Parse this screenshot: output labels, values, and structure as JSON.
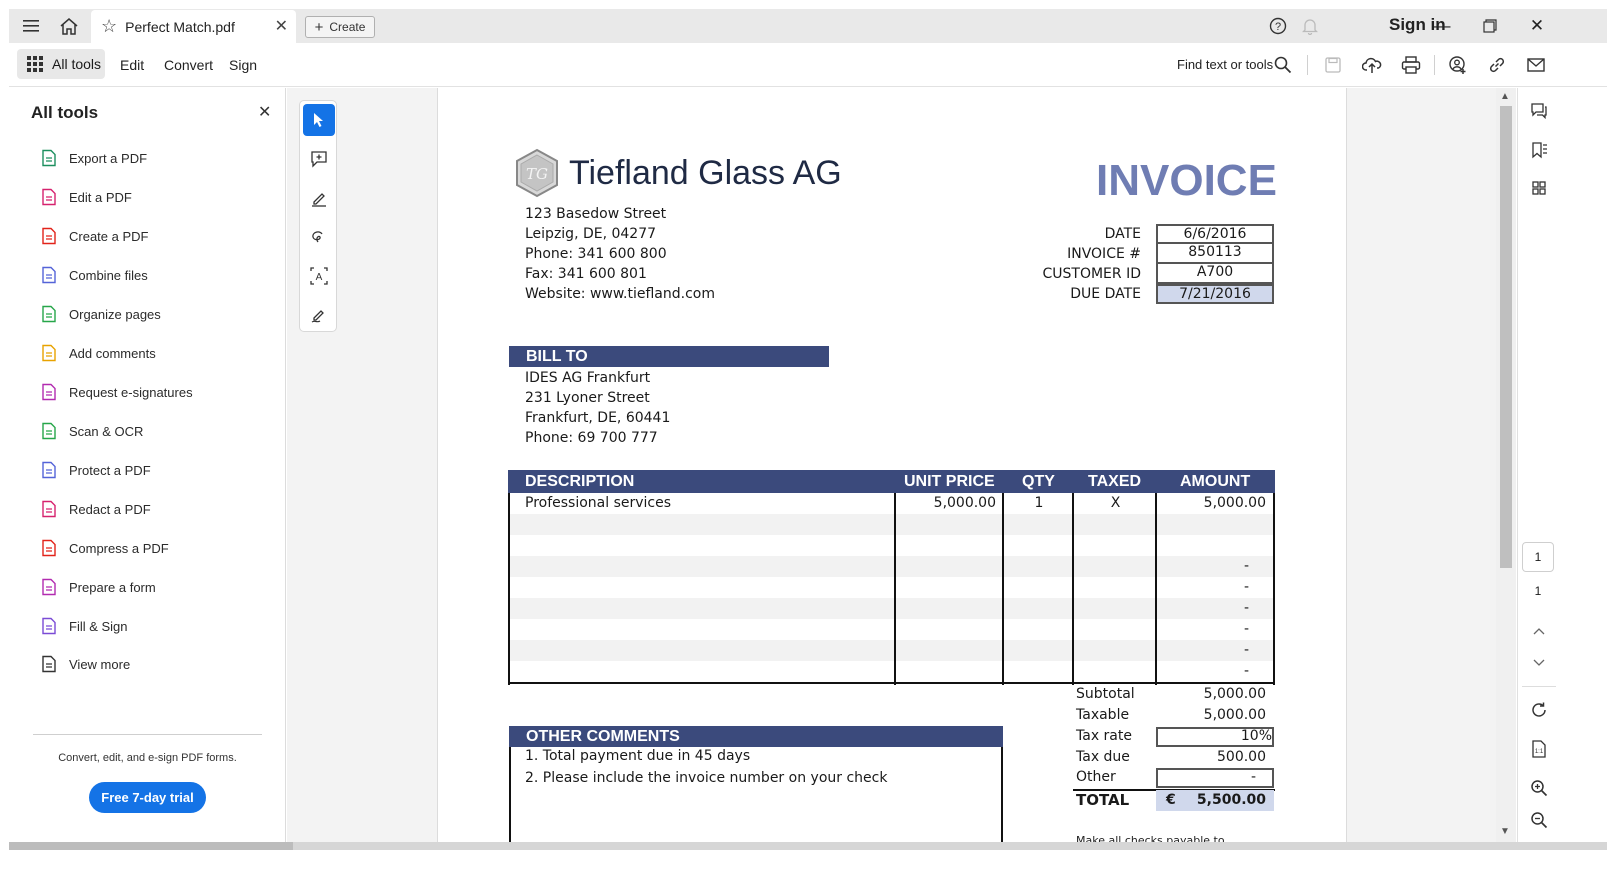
{
  "tabbar": {
    "tab_title": "Perfect Match.pdf",
    "create_label": "Create",
    "signin_label": "Sign in"
  },
  "toolbar": {
    "alltools_label": "All tools",
    "menu": [
      "Edit",
      "Convert",
      "Sign"
    ],
    "find_label": "Find text or tools"
  },
  "left_panel": {
    "title": "All tools",
    "items": [
      {
        "label": "Export a PDF",
        "icon": "export-pdf-icon",
        "color": "#1c8f5f"
      },
      {
        "label": "Edit a PDF",
        "icon": "edit-pdf-icon",
        "color": "#d6226e"
      },
      {
        "label": "Create a PDF",
        "icon": "create-pdf-icon",
        "color": "#e2231a"
      },
      {
        "label": "Combine files",
        "icon": "combine-files-icon",
        "color": "#5463d8"
      },
      {
        "label": "Organize pages",
        "icon": "organize-pages-icon",
        "color": "#26a649"
      },
      {
        "label": "Add comments",
        "icon": "add-comments-icon",
        "color": "#e8a200"
      },
      {
        "label": "Request e-signatures",
        "icon": "request-esign-icon",
        "color": "#b22bb0"
      },
      {
        "label": "Scan & OCR",
        "icon": "scan-ocr-icon",
        "color": "#26a649"
      },
      {
        "label": "Protect a PDF",
        "icon": "protect-pdf-icon",
        "color": "#5463d8"
      },
      {
        "label": "Redact a PDF",
        "icon": "redact-pdf-icon",
        "color": "#d6226e"
      },
      {
        "label": "Compress a PDF",
        "icon": "compress-pdf-icon",
        "color": "#e2231a"
      },
      {
        "label": "Prepare a form",
        "icon": "prepare-form-icon",
        "color": "#b22bb0"
      },
      {
        "label": "Fill & Sign",
        "icon": "fill-sign-icon",
        "color": "#7b4bd6"
      },
      {
        "label": "View more",
        "icon": "wrench-icon",
        "color": "#333333"
      }
    ],
    "promo_text": "Convert, edit, and e-sign PDF forms.",
    "trial_label": "Free 7-day trial"
  },
  "page_nav": {
    "current": "1",
    "total": "1"
  },
  "invoice": {
    "logo_text": "TG",
    "company": "Tiefland Glass AG",
    "title": "INVOICE",
    "address": [
      "123 Basedow Street",
      "Leipzig, DE, 04277",
      "Phone: 341 600 800",
      "Fax: 341 600 801",
      "Website: www.tiefland.com"
    ],
    "meta": [
      {
        "label": "DATE",
        "value": "6/6/2016"
      },
      {
        "label": "INVOICE #",
        "value": "850113"
      },
      {
        "label": "CUSTOMER ID",
        "value": "A700"
      },
      {
        "label": "DUE DATE",
        "value": "7/21/2016"
      }
    ],
    "bill_to_header": "BILL TO",
    "bill_to": [
      "IDES AG Frankfurt",
      "231 Lyoner Street",
      "Frankfurt, DE, 60441",
      "Phone: 69 700 777"
    ],
    "table_headers": {
      "description": "DESCRIPTION",
      "unit_price": "UNIT PRICE",
      "qty": "QTY",
      "taxed": "TAXED",
      "amount": "AMOUNT"
    },
    "line_item": {
      "description": "Professional services",
      "unit_price": "5,000.00",
      "qty": "1",
      "taxed": "X",
      "amount": "5,000.00"
    },
    "empty_amount": "-",
    "totals": {
      "subtotal_label": "Subtotal",
      "subtotal": "5,000.00",
      "taxable_label": "Taxable",
      "taxable": "5,000.00",
      "taxrate_label": "Tax rate",
      "taxrate": "10%",
      "taxdue_label": "Tax due",
      "taxdue": "500.00",
      "other_label": "Other",
      "other": "-",
      "total_label": "TOTAL",
      "currency": "€",
      "total": "5,500.00"
    },
    "comments_header": "OTHER COMMENTS",
    "comments": [
      "1. Total payment due in 45 days",
      "2. Please include the invoice number on your check"
    ],
    "footnote": "Make all checks payable to"
  }
}
